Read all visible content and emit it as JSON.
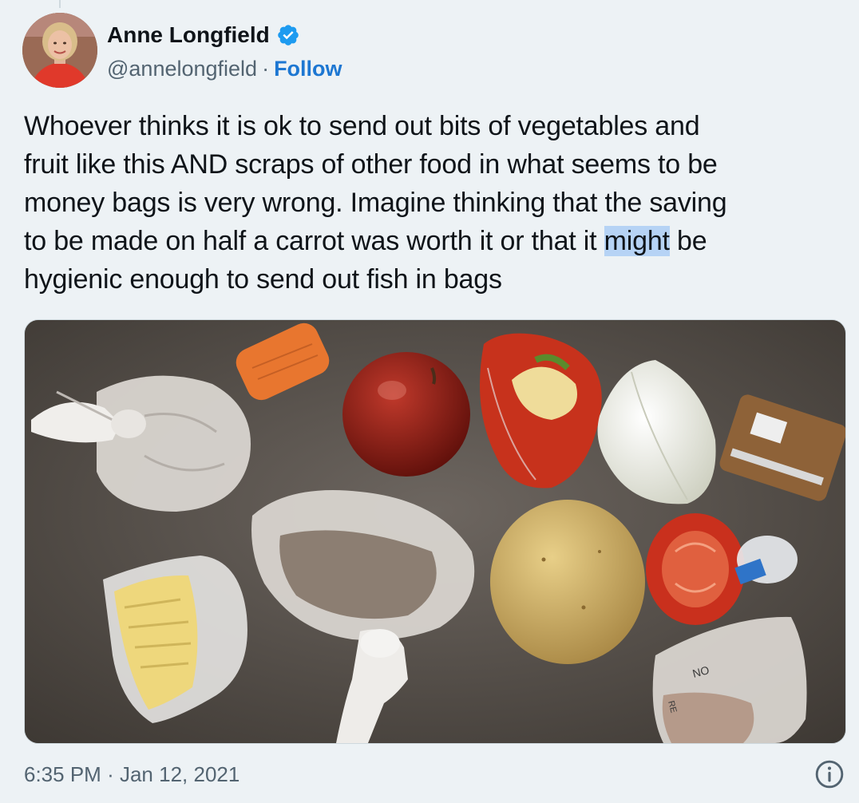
{
  "author": {
    "display_name": "Anne Longfield",
    "handle": "@annelongfield",
    "separator": "·",
    "follow_label": "Follow",
    "verified": true
  },
  "tweet": {
    "lines": [
      "Whoever thinks it is ok to send out bits of vegetables and",
      "fruit like this AND scraps of other food in what seems to be",
      "money bags is very wrong. Imagine thinking that the saving",
      "to be made on half a carrot was worth it or that it "
    ],
    "highlighted_word": "might",
    "line4_tail": " be",
    "line5": "hygienic enough to send out fish in bags"
  },
  "media": {
    "packaging_text_1": "NO",
    "packaging_text_2": "RE"
  },
  "footer": {
    "time": "6:35 PM",
    "separator": "·",
    "date": "Jan 12, 2021"
  },
  "colors": {
    "background": "#edf2f5",
    "link": "#1d77d2",
    "verified_badge": "#1d9bf0",
    "secondary_text": "#536471",
    "selection": "#b6d3f5"
  },
  "icons": {
    "verified": "verified-badge-icon",
    "info": "info-icon"
  }
}
